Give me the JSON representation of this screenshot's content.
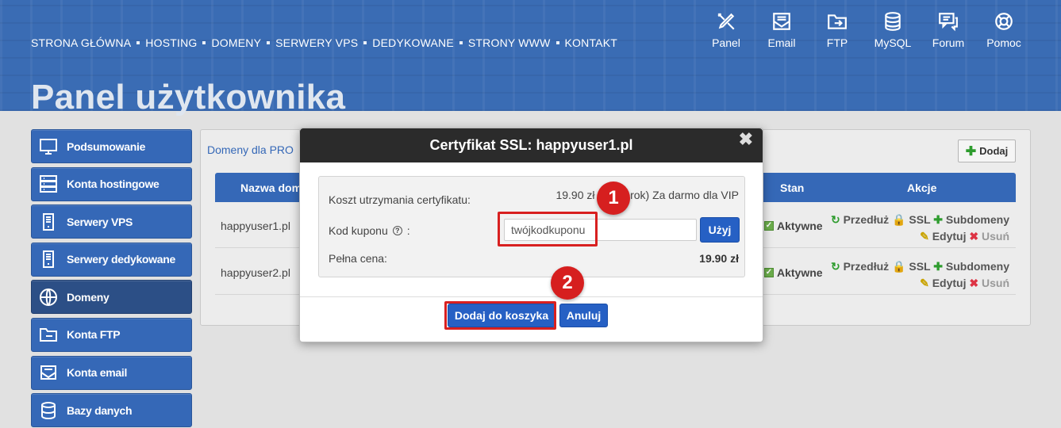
{
  "topnav": [
    "STRONA GŁÓWNA",
    "HOSTING",
    "DOMENY",
    "SERWERY VPS",
    "DEDYKOWANE",
    "STRONY WWW",
    "KONTAKT"
  ],
  "iconnav": [
    {
      "label": "Panel",
      "icon": "tools-icon"
    },
    {
      "label": "Email",
      "icon": "mail-icon"
    },
    {
      "label": "FTP",
      "icon": "folder-icon"
    },
    {
      "label": "MySQL",
      "icon": "database-icon"
    },
    {
      "label": "Forum",
      "icon": "chat-icon"
    },
    {
      "label": "Pomoc",
      "icon": "lifebuoy-icon"
    }
  ],
  "page_title": "Panel użytkownika",
  "sidebar": [
    {
      "label": "Podsumowanie",
      "icon": "monitor-icon"
    },
    {
      "label": "Konta hostingowe",
      "icon": "server-icon"
    },
    {
      "label": "Serwery VPS",
      "icon": "tower-icon"
    },
    {
      "label": "Serwery dedykowane",
      "icon": "tower-icon"
    },
    {
      "label": "Domeny",
      "icon": "globe-icon",
      "active": true
    },
    {
      "label": "Konta FTP",
      "icon": "folder-icon"
    },
    {
      "label": "Konta email",
      "icon": "mail-icon"
    },
    {
      "label": "Bazy danych",
      "icon": "database-icon"
    }
  ],
  "content": {
    "title": "Domeny dla PRO",
    "add_label": "Dodaj",
    "headers": {
      "name": "Nazwa dom",
      "stan": "Stan",
      "akcje": "Akcje"
    },
    "rows": [
      {
        "domain": "happyuser1.pl",
        "status": "Aktywne"
      },
      {
        "domain": "happyuser2.pl",
        "status": "Aktywne"
      }
    ],
    "actions": {
      "renew": "Przedłuż",
      "ssl": "SSL",
      "sub": "Subdomeny",
      "edit": "Edytuj",
      "del": "Usuń"
    }
  },
  "modal": {
    "title": "Certyfikat SSL: happyuser1.pl",
    "close": "✖",
    "cost_label": "Koszt utrzymania certyfikatu:",
    "cost_value": "19.90 zł (rok) Za darmo dla VIP",
    "cost_value_left": "19.90 zł (",
    "cost_value_right": "rok) Za darmo dla VIP",
    "coupon_label": "Kod kuponu",
    "coupon_colon": ":",
    "coupon_value": "twójkodkuponu",
    "use_label": "Użyj",
    "full_label": "Pełna cena:",
    "full_value": "19.90 zł",
    "add_cart": "Dodaj do koszyka",
    "cancel": "Anuluj"
  },
  "annotations": {
    "badge1": "1",
    "badge2": "2",
    "color": "#d61f1f"
  }
}
